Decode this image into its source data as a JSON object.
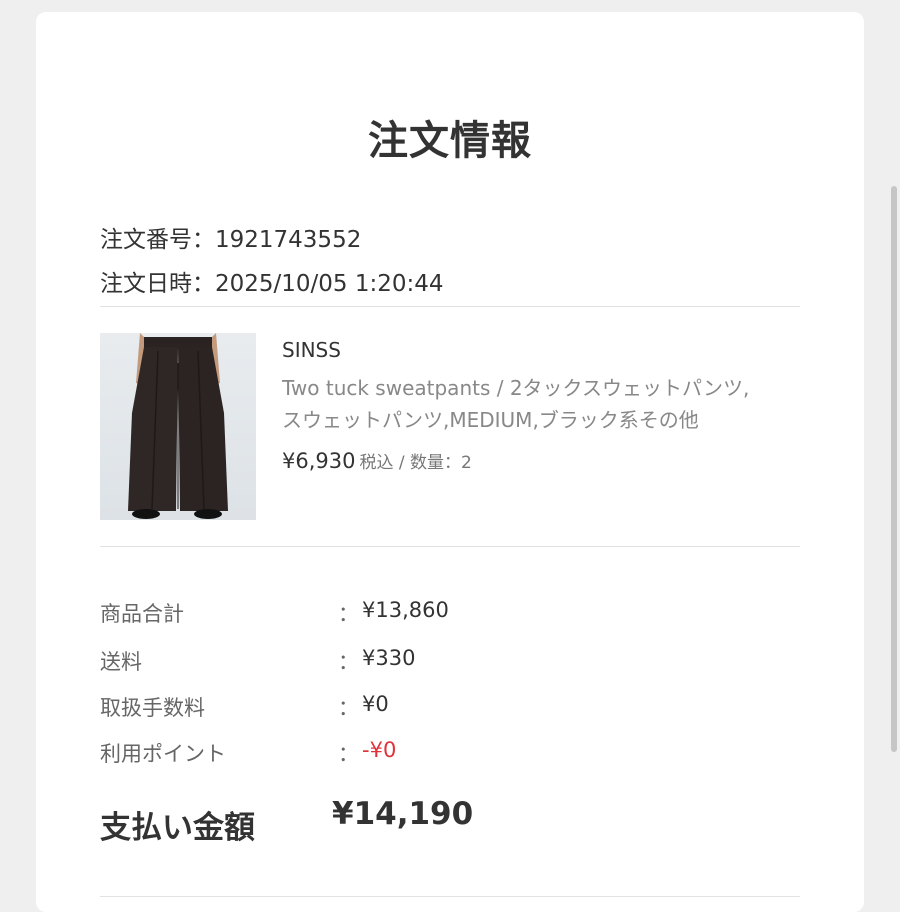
{
  "order": {
    "title": "注文情報",
    "number_label": "注文番号：",
    "number": "1921743552",
    "date_label": "注文日時：",
    "date": "2025/10/05 1:20:44"
  },
  "product": {
    "brand": "SINSS",
    "description_line1": "Two tuck sweatpants / 2タックスウェットパンツ,",
    "description_line2": "スウェットパンツ,MEDIUM,ブラック系その他",
    "price": "¥6,930",
    "price_suffix": "税込 / 数量：2"
  },
  "summary": {
    "colon": "：",
    "rows": [
      {
        "label": "商品合計",
        "value": "¥13,860"
      },
      {
        "label": "送料",
        "value": "¥330"
      },
      {
        "label": "取扱手数料",
        "value": "¥0"
      },
      {
        "label": "利用ポイント",
        "value": "-¥0"
      }
    ],
    "total_label": "支払い金額",
    "total_value": "¥14,190"
  },
  "colors": {
    "negative": "#e0323b",
    "text": "#333333",
    "muted": "#888888"
  }
}
